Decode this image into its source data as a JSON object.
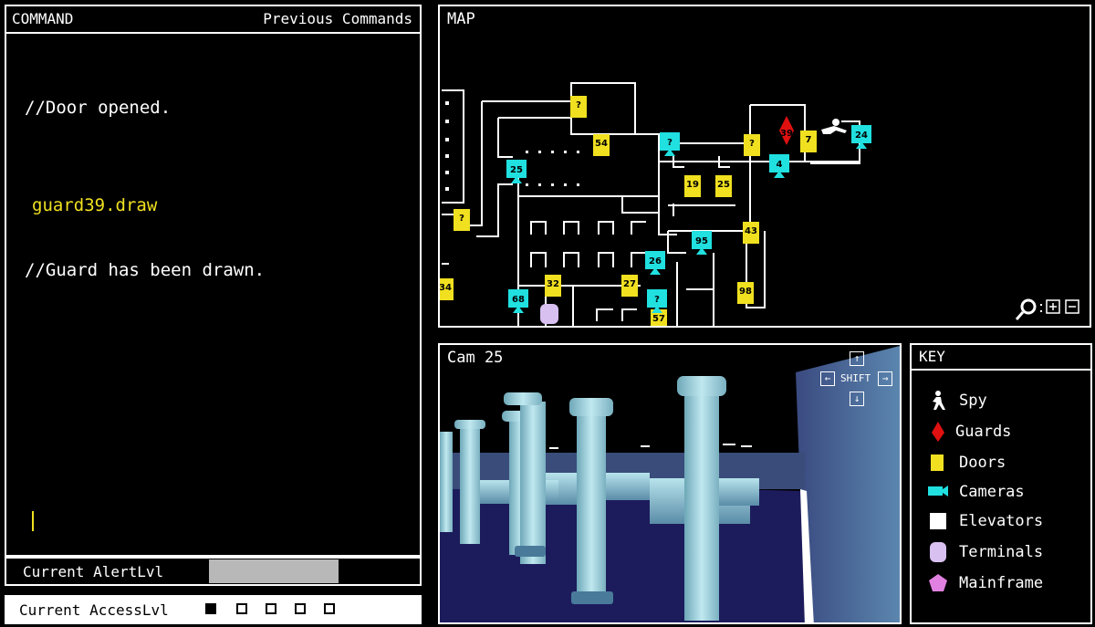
{
  "command": {
    "title": "COMMAND",
    "previous_label": "Previous Commands",
    "lines": [
      {
        "text": "//Door opened.",
        "color": "#ffffff"
      },
      {
        "text": "guard39.draw",
        "color": "#f0e020"
      },
      {
        "text": "//Guard has been drawn.",
        "color": "#ffffff"
      }
    ]
  },
  "alert": {
    "label": "Current AlertLvl",
    "level": 0.5
  },
  "access": {
    "label": "Current AccessLvl",
    "levels": [
      true,
      false,
      false,
      false,
      false
    ]
  },
  "map": {
    "title": "MAP",
    "doors": [
      {
        "label": "?"
      },
      {
        "label": "54"
      },
      {
        "label": "?"
      },
      {
        "label": "7"
      },
      {
        "label": "19"
      },
      {
        "label": "25"
      },
      {
        "label": "43"
      },
      {
        "label": "32"
      },
      {
        "label": "27"
      },
      {
        "label": "57"
      },
      {
        "label": "98"
      },
      {
        "label": "34"
      },
      {
        "label": "?"
      }
    ],
    "cameras": [
      {
        "label": "25"
      },
      {
        "label": "?"
      },
      {
        "label": "4"
      },
      {
        "label": "24"
      },
      {
        "label": "95"
      },
      {
        "label": "26"
      },
      {
        "label": "68"
      },
      {
        "label": "?"
      }
    ],
    "guard": {
      "label": "39"
    }
  },
  "camera_view": {
    "title": "Cam 25",
    "shift_label": "SHIFT"
  },
  "key": {
    "title": "KEY",
    "items": [
      {
        "label": "Spy",
        "icon": "spy-icon",
        "color": "#ffffff"
      },
      {
        "label": "Guards",
        "icon": "guard-icon",
        "color": "#e01010"
      },
      {
        "label": "Doors",
        "icon": "door-icon",
        "color": "#f0e020"
      },
      {
        "label": "Cameras",
        "icon": "camera-icon",
        "color": "#20e0e0"
      },
      {
        "label": "Elevators",
        "icon": "elevator-icon",
        "color": "#ffffff"
      },
      {
        "label": "Terminals",
        "icon": "terminal-icon",
        "color": "#d8c0f0"
      },
      {
        "label": "Mainframe",
        "icon": "mainframe-icon",
        "color": "#e080e0"
      }
    ]
  },
  "colors": {
    "door": "#f0e020",
    "camera": "#20e0e0",
    "guard": "#e01010",
    "terminal": "#d8c0f0",
    "mainframe": "#e080e0"
  }
}
